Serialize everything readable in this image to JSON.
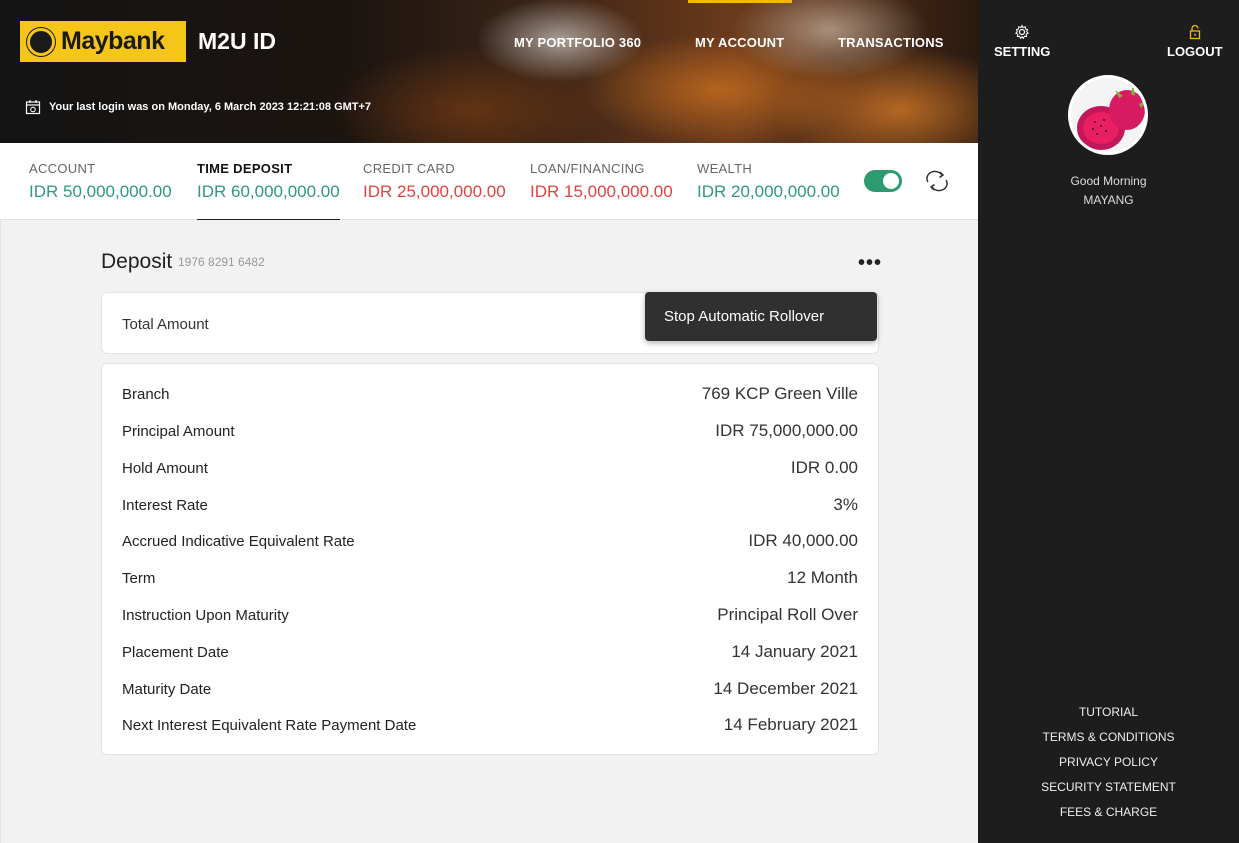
{
  "header": {
    "brand": "Maybank",
    "app_name": "M2U ID",
    "nav": [
      {
        "label": "MY PORTFOLIO 360"
      },
      {
        "label": "MY ACCOUNT"
      },
      {
        "label": "TRANSACTIONS"
      }
    ],
    "last_login": "Your last login was on Monday, 6 March 2023 12:21:08 GMT+7"
  },
  "sidebar": {
    "setting_label": "SETTING",
    "logout_label": "LOGOUT",
    "greeting": "Good Morning",
    "user_name": "MAYANG",
    "links": [
      "TUTORIAL",
      "TERMS & CONDITIONS",
      "PRIVACY POLICY",
      "SECURITY STATEMENT",
      "FEES & CHARGE"
    ]
  },
  "summary": [
    {
      "label": "ACCOUNT",
      "value": "IDR 50,000,000.00",
      "color": "#2e9a7f"
    },
    {
      "label": "TIME DEPOSIT",
      "value": "IDR 60,000,000.00",
      "color": "#2e9a7f"
    },
    {
      "label": "CREDIT CARD",
      "value": "IDR 25,000,000.00",
      "color": "#e0443f"
    },
    {
      "label": "LOAN/FINANCING",
      "value": "IDR 15,000,000.00",
      "color": "#e0443f"
    },
    {
      "label": "WEALTH",
      "value": "IDR 20,000,000.00",
      "color": "#2e9a7f"
    }
  ],
  "deposit": {
    "title": "Deposit",
    "account_no": "1976 8291 6482",
    "more_label": "•••",
    "total_label": "Total Amount",
    "menu_item": "Stop Automatic Rollover",
    "details": [
      {
        "label": "Branch",
        "value": "769 KCP Green Ville"
      },
      {
        "label": "Principal Amount",
        "value": "IDR 75,000,000.00"
      },
      {
        "label": "Hold Amount",
        "value": "IDR 0.00"
      },
      {
        "label": "Interest Rate",
        "value": "3%"
      },
      {
        "label": "Accrued Indicative Equivalent Rate",
        "value": "IDR 40,000.00"
      },
      {
        "label": "Term",
        "value": "12 Month"
      },
      {
        "label": "Instruction Upon Maturity",
        "value": "Principal Roll Over"
      },
      {
        "label": "Placement Date",
        "value": "14 January 2021"
      },
      {
        "label": "Maturity Date",
        "value": "14 December 2021"
      },
      {
        "label": "Next Interest Equivalent Rate Payment Date",
        "value": "14 February 2021"
      }
    ]
  },
  "colors": {
    "brand_yellow": "#f5c518",
    "positive": "#2e9a7f",
    "negative": "#e0443f",
    "sidebar_bg": "#1d1d1d"
  }
}
